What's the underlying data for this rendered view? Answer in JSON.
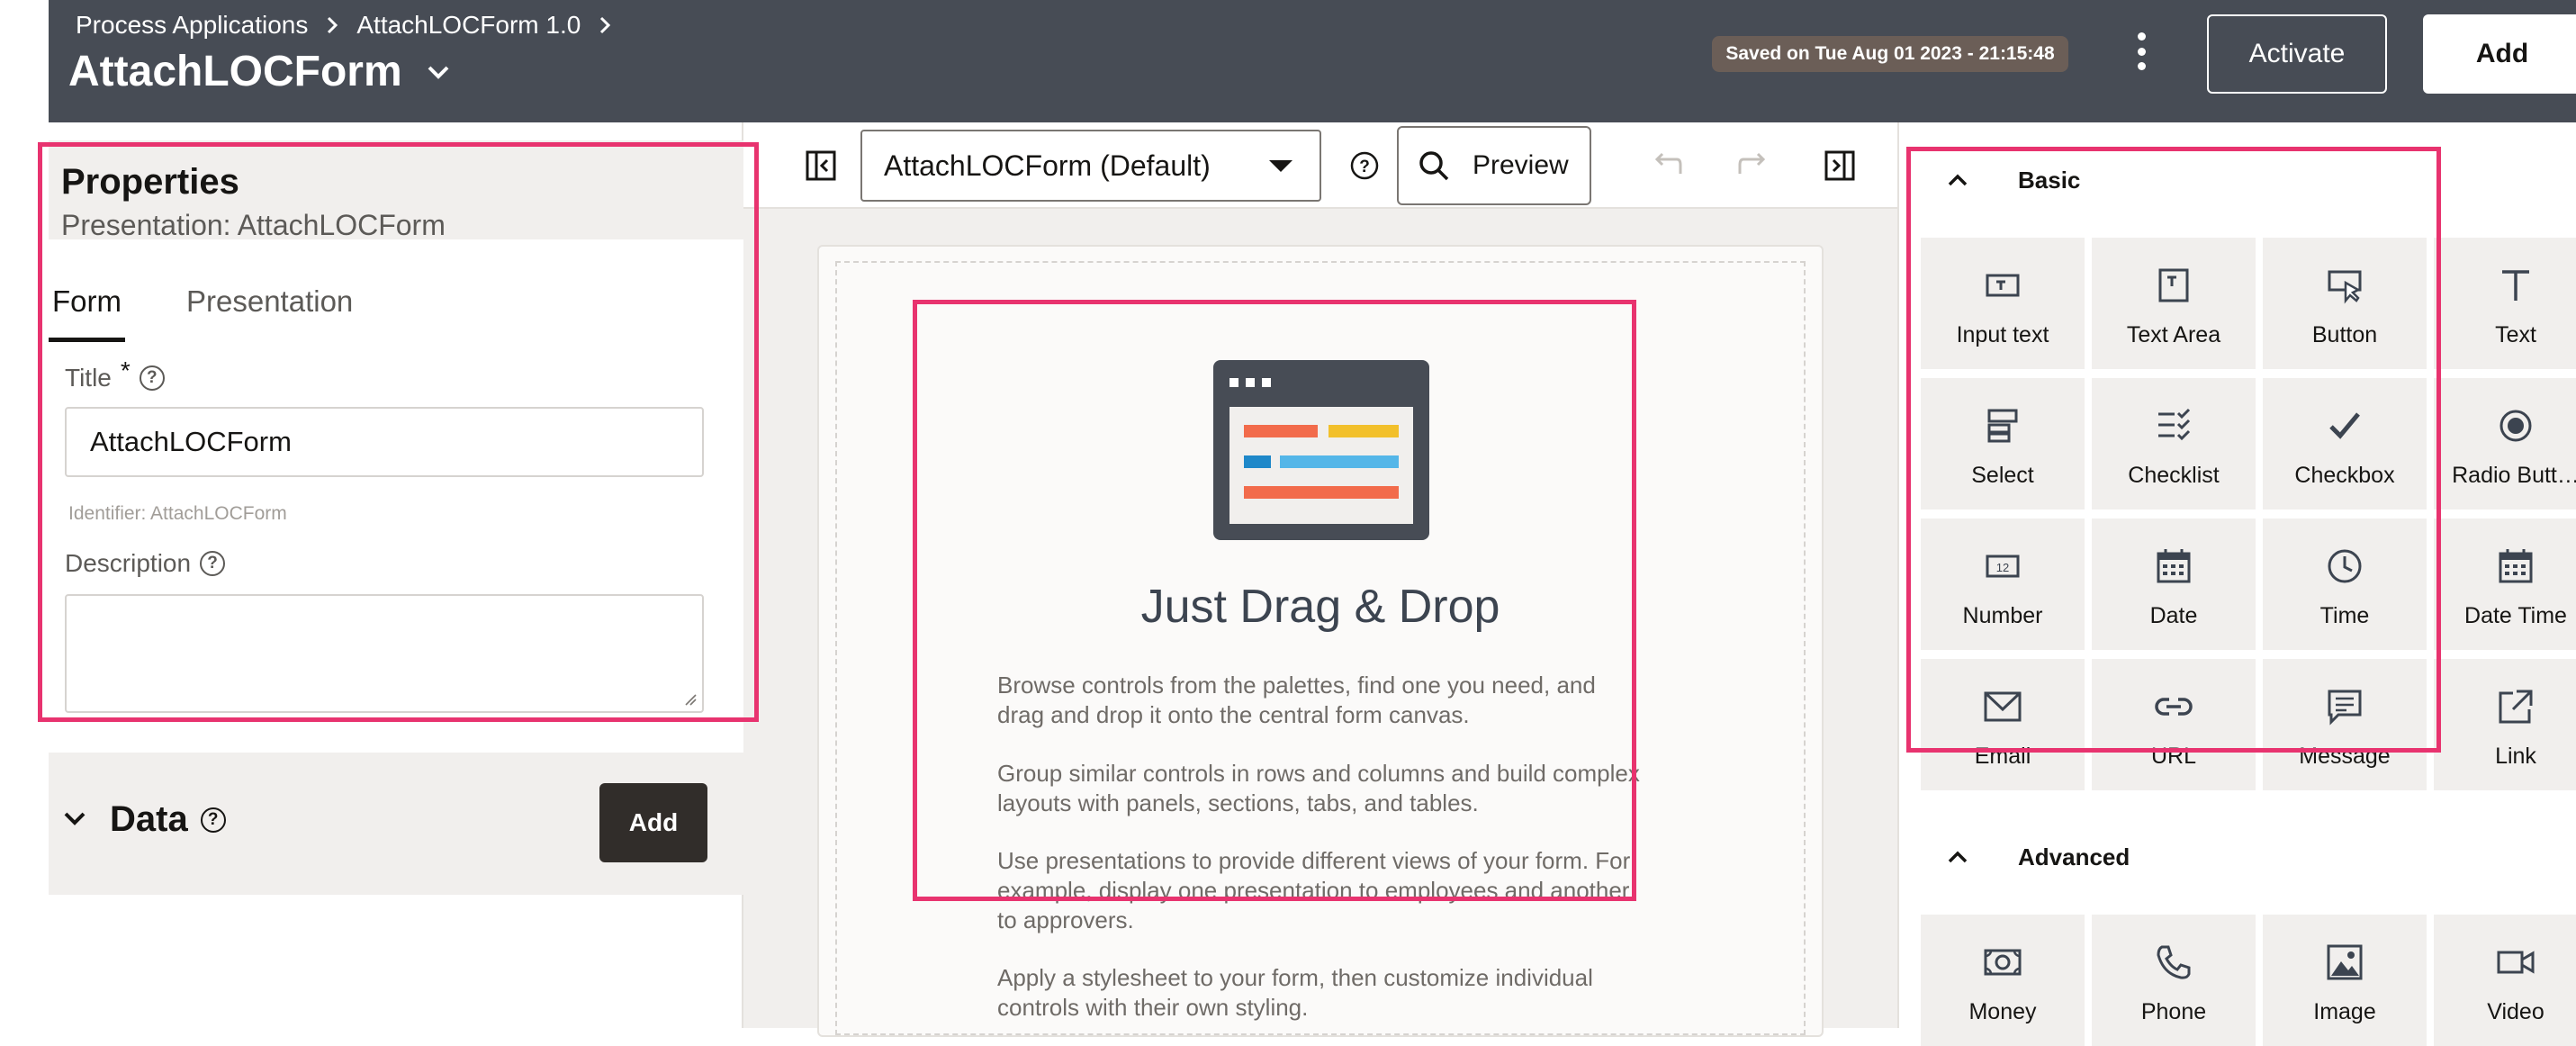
{
  "header": {
    "breadcrumbs": [
      "Process Applications",
      "AttachLOCForm 1.0"
    ],
    "title": "AttachLOCForm",
    "saved_status": "Saved on Tue Aug 01 2023 - 21:15:48",
    "activate_label": "Activate",
    "add_label": "Add"
  },
  "properties": {
    "title": "Properties",
    "subtitle": "Presentation: AttachLOCForm",
    "tabs": [
      {
        "label": "Form",
        "active": true
      },
      {
        "label": "Presentation",
        "active": false
      }
    ],
    "title_field": {
      "label": "Title",
      "required_marker": "*",
      "value": "AttachLOCForm",
      "identifier": "Identifier: AttachLOCForm"
    },
    "description_field": {
      "label": "Description",
      "value": ""
    }
  },
  "data_section": {
    "title": "Data",
    "add_label": "Add"
  },
  "toolbar": {
    "presentation_select": "AttachLOCForm (Default)",
    "preview_label": "Preview"
  },
  "canvas": {
    "heading": "Just Drag & Drop",
    "paragraphs": [
      "Browse controls from the palettes, find one you need, and drag and drop it onto the central form canvas.",
      "Group similar controls in rows and columns and build complex layouts with panels, sections, tabs, and tables.",
      "Use presentations to provide different views of your form. For example, display one presentation to employees and another to approvers.",
      "Apply a stylesheet to your form, then customize individual controls with their own styling."
    ]
  },
  "palette": {
    "basic": {
      "label": "Basic",
      "items": [
        {
          "label": "Input text",
          "icon": "input-text-icon"
        },
        {
          "label": "Text Area",
          "icon": "text-area-icon"
        },
        {
          "label": "Button",
          "icon": "button-icon"
        },
        {
          "label": "Text",
          "icon": "text-icon"
        },
        {
          "label": "Select",
          "icon": "select-icon"
        },
        {
          "label": "Checklist",
          "icon": "checklist-icon"
        },
        {
          "label": "Checkbox",
          "icon": "checkbox-icon"
        },
        {
          "label": "Radio Butt…",
          "icon": "radio-button-icon"
        },
        {
          "label": "Number",
          "icon": "number-icon"
        },
        {
          "label": "Date",
          "icon": "date-icon"
        },
        {
          "label": "Time",
          "icon": "time-icon"
        },
        {
          "label": "Date Time",
          "icon": "date-time-icon"
        },
        {
          "label": "Email",
          "icon": "email-icon"
        },
        {
          "label": "URL",
          "icon": "url-icon"
        },
        {
          "label": "Message",
          "icon": "message-icon"
        },
        {
          "label": "Link",
          "icon": "link-icon"
        }
      ]
    },
    "advanced": {
      "label": "Advanced",
      "items": [
        {
          "label": "Money",
          "icon": "money-icon"
        },
        {
          "label": "Phone",
          "icon": "phone-icon"
        },
        {
          "label": "Image",
          "icon": "image-icon"
        },
        {
          "label": "Video",
          "icon": "video-icon"
        }
      ]
    }
  },
  "colors": {
    "header_bg": "#474c55",
    "highlight": "#e8336f",
    "panel_bg": "#f1efed",
    "dark_button": "#312d2a",
    "saved_badge": "#6b5e57"
  }
}
